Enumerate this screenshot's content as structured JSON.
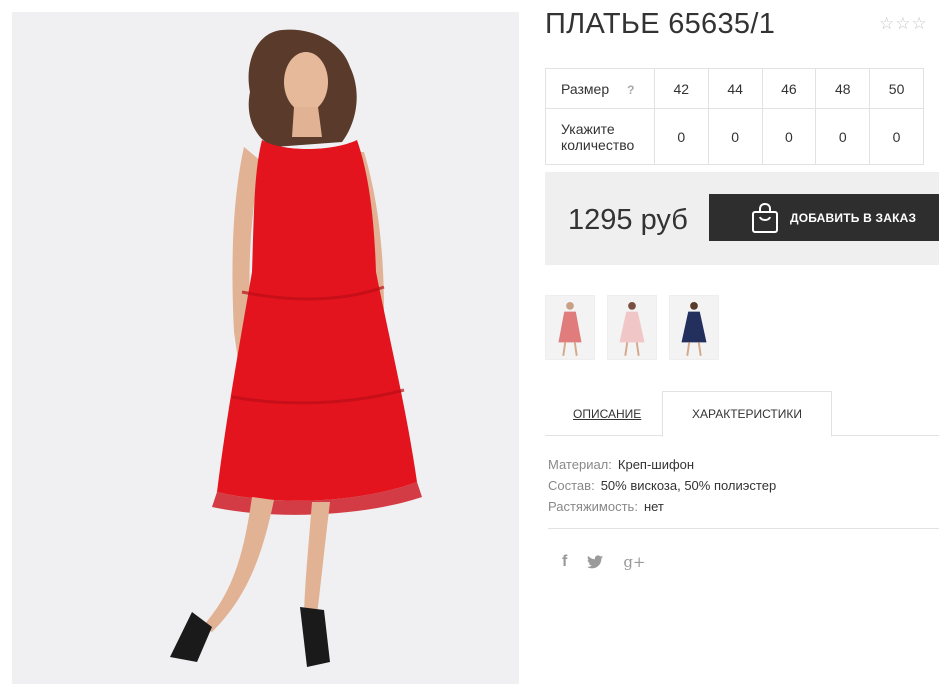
{
  "product": {
    "title": "ПЛАТЬЕ 65635/1",
    "rating_icon": "star-outline-icon",
    "rating_stars": 0
  },
  "sizes": {
    "header_label": "Размер",
    "help_label": "?",
    "values": [
      "42",
      "44",
      "46",
      "48",
      "50"
    ],
    "qty_label": "Укажите количество",
    "quantities": [
      "0",
      "0",
      "0",
      "0",
      "0"
    ]
  },
  "buy": {
    "price": "1295 руб",
    "add_button_label": "ДОБАВИТЬ В ЗАКАЗ",
    "add_button_icon": "shopping-bag-icon"
  },
  "thumbnails": [
    {
      "name": "red-dress-thumb",
      "color": "#e07c7c"
    },
    {
      "name": "pink-dress-thumb",
      "color": "#f0c6c6"
    },
    {
      "name": "navy-dress-thumb",
      "color": "#23305e"
    }
  ],
  "tabs": {
    "description": "ОПИСАНИЕ",
    "characteristics": "ХАРАКТЕРИСТИКИ",
    "active": "characteristics"
  },
  "specs": [
    {
      "key": "Материал:",
      "value": "Креп-шифон"
    },
    {
      "key": "Состав:",
      "value": "50% вискоза, 50% полиэстер"
    },
    {
      "key": "Растяжимость:",
      "value": "нет"
    }
  ],
  "social": {
    "facebook_label": "f",
    "twitter_label": "🐦",
    "googleplus_label": "g+"
  },
  "colors": {
    "dress_red": "#e4141e",
    "button_dark": "#2e2e2e",
    "buybox_bg": "#efefef"
  }
}
